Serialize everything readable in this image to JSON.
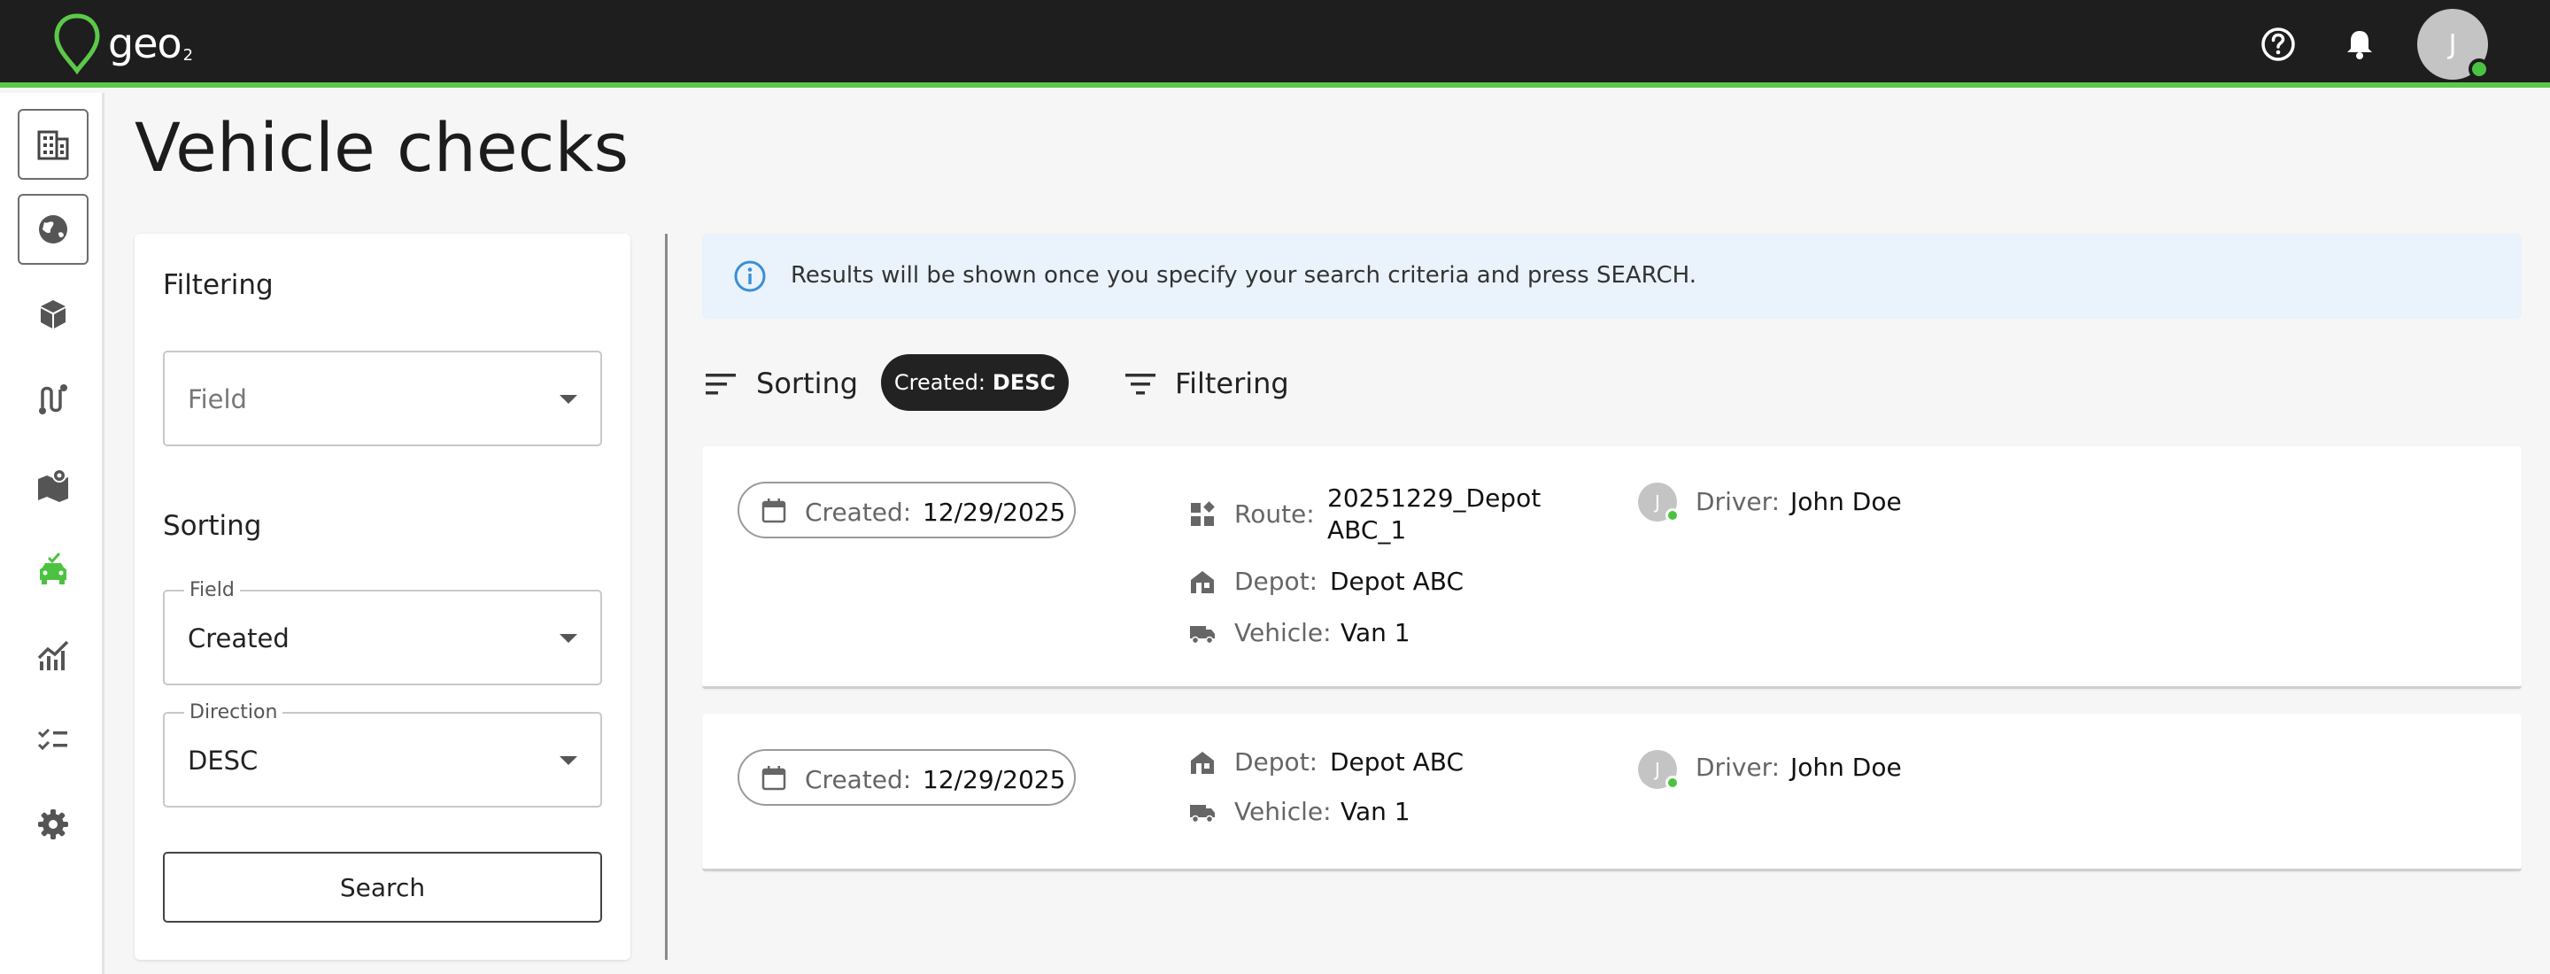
{
  "app": {
    "logo_text": "geo",
    "logo_sub": "2"
  },
  "topbar": {
    "avatar_initial": "J",
    "accent_color": "#5cc84a"
  },
  "page": {
    "title": "Vehicle checks"
  },
  "filter_panel": {
    "filtering_heading": "Filtering",
    "filter_field_placeholder": "Field",
    "sorting_heading": "Sorting",
    "sort_field_legend": "Field",
    "sort_field_value": "Created",
    "direction_legend": "Direction",
    "direction_value": "DESC",
    "search_label": "Search"
  },
  "info": {
    "text": "Results will be shown once you specify your search criteria and press SEARCH."
  },
  "toolbar": {
    "sorting_label": "Sorting",
    "chip_key": "Created:",
    "chip_value": "DESC",
    "filtering_label": "Filtering"
  },
  "results": [
    {
      "created_label": "Created:",
      "created_value": "12/29/2025",
      "route_label": "Route:",
      "route_line1": "20251229_Depot",
      "route_line2": "ABC_1",
      "depot_label": "Depot:",
      "depot_value": "Depot ABC",
      "vehicle_label": "Vehicle:",
      "vehicle_value": "Van 1",
      "driver_label": "Driver:",
      "driver_value": "John Doe",
      "driver_initial": "J"
    },
    {
      "created_label": "Created:",
      "created_value": "12/29/2025",
      "depot_label": "Depot:",
      "depot_value": "Depot ABC",
      "vehicle_label": "Vehicle:",
      "vehicle_value": "Van 1",
      "driver_label": "Driver:",
      "driver_value": "John Doe",
      "driver_initial": "J"
    }
  ],
  "nav_icons": [
    "buildings-icon",
    "globe-icon",
    "packages-icon",
    "route-icon",
    "map-icon",
    "vehicle-check-icon",
    "analytics-icon",
    "checklist-icon",
    "settings-icon"
  ]
}
